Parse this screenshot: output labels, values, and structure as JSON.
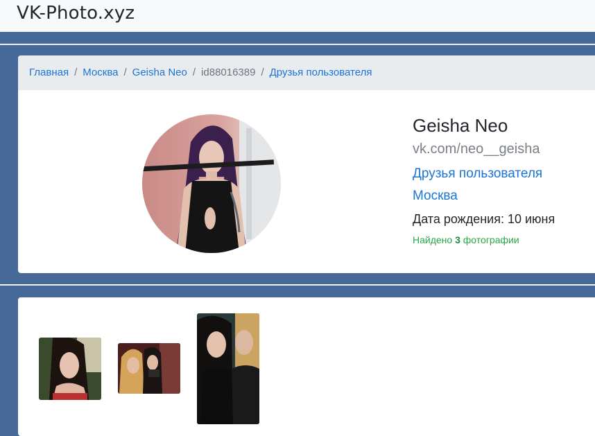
{
  "site": {
    "title": "VK-Photo.xyz"
  },
  "breadcrumb": {
    "home": "Главная",
    "city": "Москва",
    "user": "Geisha Neo",
    "id": "id88016389",
    "friends": "Друзья пользователя",
    "separator": "/"
  },
  "profile": {
    "name": "Geisha Neo",
    "vk_link": "vk.com/neo__geisha",
    "friends_link": "Друзья пользователя",
    "city_link": "Москва",
    "birthday": "Дата рождения: 10 июня",
    "found_prefix": "Найдено",
    "found_count": "3",
    "found_suffix": "фотографии"
  },
  "colors": {
    "background": "#46699a",
    "link": "#1a74d6",
    "success": "#28a745"
  }
}
